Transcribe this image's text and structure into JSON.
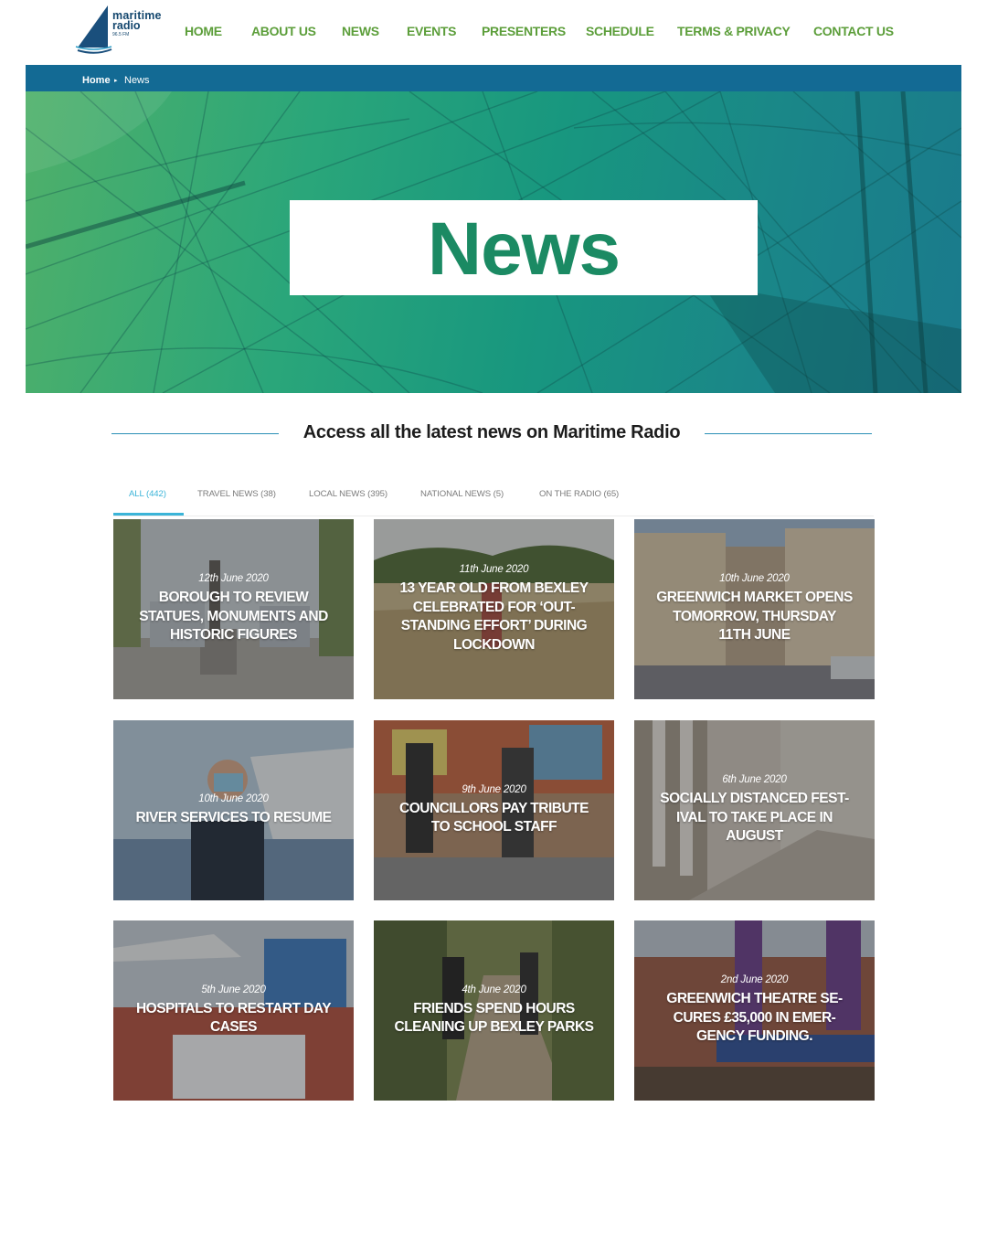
{
  "header": {
    "logo": {
      "line1": "maritime",
      "line2": "radio",
      "freq": "96.5 FM"
    },
    "nav": [
      "HOME",
      "ABOUT US",
      "NEWS",
      "EVENTS",
      "PRESENTERS",
      "SCHEDULE",
      "TERMS & PRIVACY",
      "CONTACT US"
    ]
  },
  "breadcrumb": {
    "home": "Home",
    "separator": "▸",
    "current": "News"
  },
  "hero": {
    "title": "News"
  },
  "section": {
    "title": "Access all the latest news on Maritime Radio"
  },
  "tabs": [
    {
      "label": "ALL (442)",
      "active": true
    },
    {
      "label": "TRAVEL NEWS (38)",
      "active": false
    },
    {
      "label": "LOCAL NEWS (395)",
      "active": false
    },
    {
      "label": "NATIONAL NEWS (5)",
      "active": false
    },
    {
      "label": "ON THE RADIO (65)",
      "active": false
    }
  ],
  "articles": [
    {
      "date": "12th June 2020",
      "title_lines": [
        "BOROUGH TO REVIEW",
        "STATUES, MONUMENTS AND",
        "HISTORIC FIGURES"
      ]
    },
    {
      "date": "11th June 2020",
      "title_lines": [
        "13 YEAR OLD FROM BEXLEY",
        "CELEBRATED FOR ‘OUT-",
        "STANDING EFFORT’ DURING",
        "LOCKDOWN"
      ]
    },
    {
      "date": "10th June 2020",
      "title_lines": [
        "GREENWICH MARKET OPENS",
        "TOMORROW, THURSDAY",
        "11TH JUNE"
      ]
    },
    {
      "date": "10th June 2020",
      "title_lines": [
        "RIVER SERVICES TO RESUME"
      ]
    },
    {
      "date": "9th June 2020",
      "title_lines": [
        "COUNCILLORS PAY TRIBUTE",
        "TO SCHOOL STAFF"
      ]
    },
    {
      "date": "6th June 2020",
      "title_lines": [
        "SOCIALLY DISTANCED FEST-",
        "IVAL TO TAKE PLACE IN",
        "AUGUST"
      ]
    },
    {
      "date": "5th June 2020",
      "title_lines": [
        "HOSPITALS TO RESTART DAY",
        "CASES"
      ]
    },
    {
      "date": "4th June 2020",
      "title_lines": [
        "FRIENDS SPEND HOURS",
        "CLEANING UP BEXLEY PARKS"
      ]
    },
    {
      "date": "2nd June 2020",
      "title_lines": [
        "GREENWICH THEATRE SE-",
        "CURES £35,000 IN EMER-",
        "GENCY FUNDING."
      ]
    }
  ],
  "colors": {
    "nav_green": "#5c9e3a",
    "breadcrumb_blue": "#136a94",
    "tab_active": "#3bb4d8",
    "hero_text": "#1b8a63"
  }
}
